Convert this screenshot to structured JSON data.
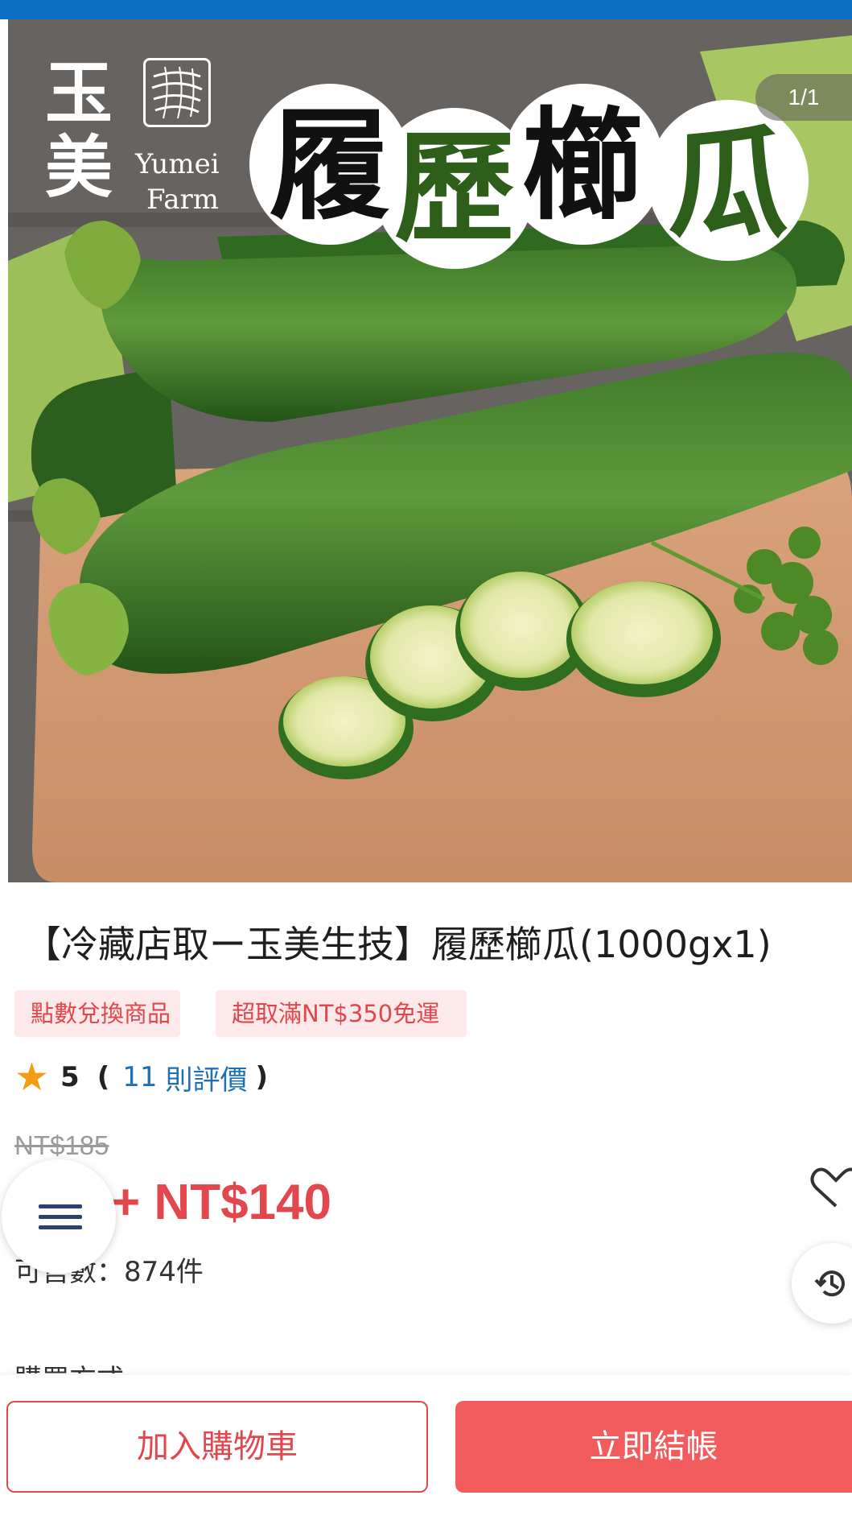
{
  "status_bar": {
    "color": "#0d6fc4"
  },
  "hero": {
    "brand_cn": "玉美",
    "brand_en_line1": "Yumei",
    "brand_en_line2": "Farm",
    "title_chars": [
      "履",
      "歷",
      "櫛",
      "瓜"
    ],
    "image_counter": "1/1"
  },
  "product": {
    "title": "【冷藏店取ー玉美生技】履歷櫛瓜(1000gx1)",
    "tags": [
      "點數兌換商品",
      "超取滿NT$350免運"
    ],
    "rating_score": "5",
    "rating_open_paren": "(",
    "review_count": "11",
    "review_word": "則評價",
    "rating_close_paren": ")",
    "original_price": "NT$185",
    "sale_price": "+ NT$140",
    "stock_label": "可售數：",
    "stock_value": "874件",
    "purchase_method_label": "購買方式"
  },
  "actions": {
    "add_to_cart": "加入購物車",
    "buy_now": "立即結帳"
  },
  "colors": {
    "accent_red": "#e3474e",
    "buy_button": "#f35c5c",
    "tag_bg": "#fde9e9",
    "link_blue": "#1f6fb5",
    "star": "#f39c12"
  },
  "icons": [
    "menu-icon",
    "heart-icon",
    "history-icon",
    "star-icon",
    "brand-logo-icon"
  ]
}
